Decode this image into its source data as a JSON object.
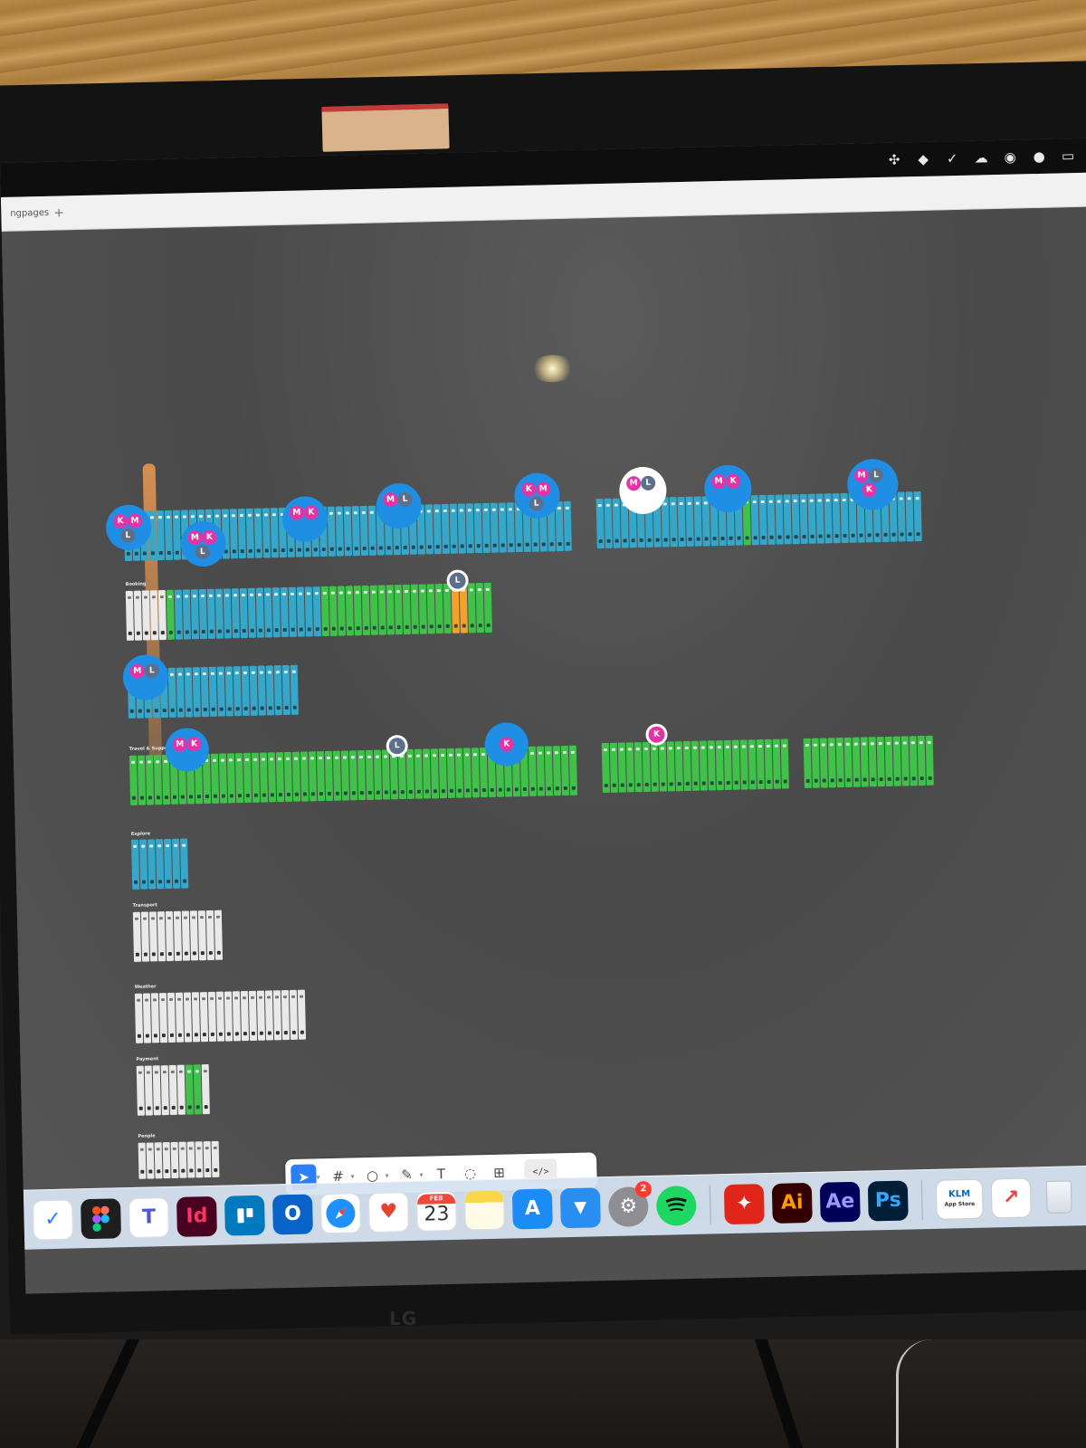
{
  "browser": {
    "tab_label": "ngpages",
    "new_tab": "+"
  },
  "tray_icons": [
    "figma-tray-icon",
    "dropbox-icon",
    "checkmark-circle-icon",
    "cloud-icon",
    "camera-icon",
    "record-icon",
    "display-icon"
  ],
  "canvas": {
    "sections": [
      {
        "label": "Booking",
        "color": "blue"
      },
      {
        "label": "Travel & Support",
        "color": "green"
      },
      {
        "label": "Explore",
        "color": "blue"
      },
      {
        "label": "Transport",
        "color": "white"
      },
      {
        "label": "Weather",
        "color": "white"
      },
      {
        "label": "Payment",
        "color": "white"
      },
      {
        "label": "People",
        "color": "white"
      }
    ],
    "collaborator_clusters": [
      {
        "initials": [
          "K",
          "M",
          "L"
        ]
      },
      {
        "initials": [
          "M",
          "K",
          "L"
        ]
      },
      {
        "initials": [
          "M",
          "K"
        ]
      },
      {
        "initials": [
          "M",
          "L"
        ]
      },
      {
        "initials": [
          "K",
          "M",
          "L"
        ]
      },
      {
        "initials": [
          "M",
          "L"
        ]
      },
      {
        "initials": [
          "M",
          "K"
        ]
      },
      {
        "initials": [
          "M",
          "L",
          "K"
        ]
      },
      {
        "initials": [
          "M",
          "L"
        ]
      },
      {
        "initials": [
          "M",
          "K"
        ]
      },
      {
        "initials": [
          "K"
        ]
      }
    ],
    "lone_cursors": [
      "L",
      "L",
      "K"
    ]
  },
  "toolbar": {
    "tools": [
      {
        "name": "move-tool",
        "glyph": "➤",
        "active": true
      },
      {
        "name": "frame-tool",
        "glyph": "#",
        "active": false
      },
      {
        "name": "shape-tool",
        "glyph": "○",
        "active": false
      },
      {
        "name": "pen-tool",
        "glyph": "✎",
        "active": false
      },
      {
        "name": "text-tool",
        "glyph": "T",
        "active": false
      },
      {
        "name": "comment-tool",
        "glyph": "◌",
        "active": false
      },
      {
        "name": "actions-tool",
        "glyph": "⊞",
        "active": false
      }
    ],
    "code_glyph": "</>"
  },
  "dock": {
    "calendar": {
      "month": "FEB",
      "day": "23"
    },
    "settings_badge": "2",
    "illustrator_label": "Ai",
    "aftereffects_label": "Ae",
    "photoshop_label": "Ps",
    "indesign_label": "Id",
    "klm_label_top": "KLM",
    "klm_label_bottom": "App Store"
  },
  "monitor_brand": "LG",
  "colors": {
    "frame_blue": "#36a6c9",
    "frame_green": "#3fc14a",
    "frame_orange": "#f2a22c",
    "cluster_blue": "#1f8fe6",
    "avatar_pink": "#e234a6",
    "avatar_slate": "#5d6f8a",
    "toolbar_active": "#2d7ff9"
  }
}
